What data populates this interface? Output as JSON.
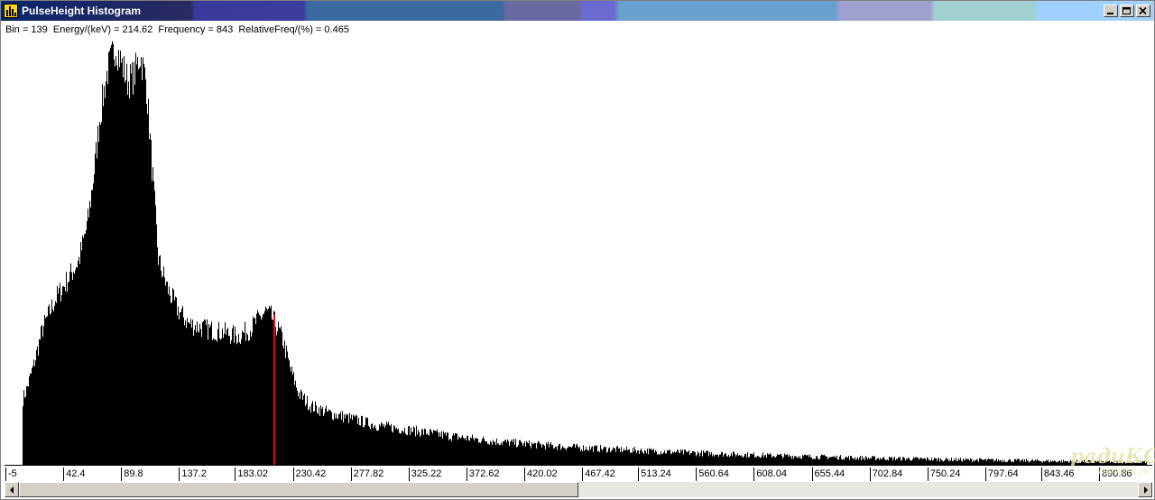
{
  "window": {
    "title": "PulseHeight Histogram",
    "icon": "histogram-app-icon",
    "buttons": [
      "minimize",
      "maximize",
      "close"
    ]
  },
  "status": {
    "bin_label": "Bin",
    "bin": "139",
    "energy_label": "Energy/(keV)",
    "energy": "214.62",
    "frequency_label": "Frequency",
    "frequency": "843",
    "relfreq_label": "RelativeFreq/(%)",
    "relfreq": "0.465",
    "text": "Bin = 139  Energy/(keV) = 214.62  Frequency = 843  RelativeFreq/(%) = 0.465"
  },
  "colors": {
    "bars": "#000000",
    "cursor": "#ff0000",
    "background": "#ffffff"
  },
  "chart_data": {
    "type": "bar",
    "xlim": [
      -5,
      930
    ],
    "ylim": [
      0,
      2400
    ],
    "cursor_energy": 214.62,
    "cursor_frequency": 843,
    "x_tick_labels": [
      "-5",
      "42.4",
      "89.8",
      "137.2",
      "183.02",
      "230.42",
      "277.82",
      "325.22",
      "372.62",
      "420.02",
      "467.42",
      "513.24",
      "560.64",
      "608.04",
      "655.44",
      "702.84",
      "750.24",
      "797.64",
      "843.46",
      "890.86"
    ],
    "x_tick_values": [
      -5,
      42.4,
      89.8,
      137.2,
      183.02,
      230.42,
      277.82,
      325.22,
      372.62,
      420.02,
      467.42,
      513.24,
      560.64,
      608.04,
      655.44,
      702.84,
      750.24,
      797.64,
      843.46,
      890.86
    ],
    "envelope": {
      "x": [
        9,
        12,
        18,
        25,
        35,
        45,
        55,
        62,
        68,
        72,
        78,
        85,
        90,
        95,
        100,
        105,
        110,
        115,
        120,
        128,
        135,
        145,
        160,
        175,
        185,
        195,
        205,
        208,
        212,
        216,
        222,
        228,
        235,
        245,
        260,
        280,
        300,
        330,
        360,
        400,
        450,
        500,
        560,
        620,
        700,
        780,
        860,
        930
      ],
      "y": [
        370,
        420,
        560,
        760,
        920,
        1030,
        1150,
        1350,
        1680,
        1950,
        2200,
        2350,
        2250,
        2150,
        2180,
        2300,
        2150,
        1650,
        1150,
        980,
        880,
        790,
        760,
        740,
        720,
        760,
        840,
        860,
        835,
        790,
        700,
        540,
        400,
        330,
        290,
        255,
        220,
        190,
        160,
        128,
        102,
        84,
        66,
        52,
        38,
        28,
        20,
        15
      ]
    }
  },
  "scrollbar": {
    "left_arrow": "scroll-left-arrow-icon",
    "right_arrow": "scroll-right-arrow-icon"
  },
  "watermark": {
    "big": "радиКОТ",
    "small": "radiokot.ru"
  }
}
